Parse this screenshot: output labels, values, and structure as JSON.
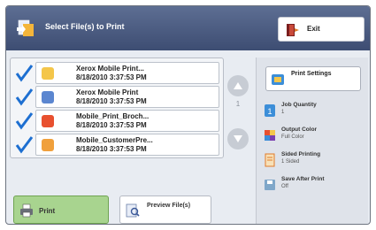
{
  "header": {
    "title": "Select File(s) to Print",
    "exit_label": "Exit"
  },
  "files": [
    {
      "name": "Xerox Mobile Print...",
      "date": "8/18/2010 3:37:53 PM",
      "checked": true,
      "icon_color": "#f4c64a"
    },
    {
      "name": "Xerox Mobile Print",
      "date": "8/18/2010 3:37:53 PM",
      "checked": true,
      "icon_color": "#5b86d0"
    },
    {
      "name": "Mobile_Print_Broch...",
      "date": "8/18/2010 3:37:53 PM",
      "checked": true,
      "icon_color": "#e8502f"
    },
    {
      "name": "Mobile_CustomerPre...",
      "date": "8/18/2010 3:37:53 PM",
      "checked": true,
      "icon_color": "#f0a03c"
    }
  ],
  "pager": {
    "indicator": "1"
  },
  "right_panel": {
    "print_settings_label": "Print Settings",
    "options": [
      {
        "label": "Job Quantity",
        "value": "1",
        "icon": "quantity-icon"
      },
      {
        "label": "Output Color",
        "value": "Full Color",
        "icon": "color-icon"
      },
      {
        "label": "Sided Printing",
        "value": "1 Sided",
        "icon": "sided-icon"
      },
      {
        "label": "Save After Print",
        "value": "Off",
        "icon": "save-icon"
      }
    ]
  },
  "actions": {
    "print_label": "Print",
    "preview_label": "Preview File(s)"
  },
  "colors": {
    "header": "#4a5a80",
    "print_button": "#a8d48f",
    "check": "#1d6fd1"
  }
}
